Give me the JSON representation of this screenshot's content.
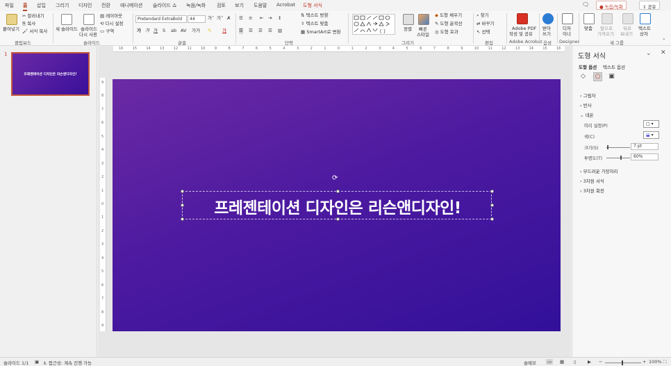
{
  "tabs": [
    "파일",
    "홈",
    "삽입",
    "그리기",
    "디자인",
    "전환",
    "애니메이션",
    "슬라이드 쇼",
    "녹음/녹화",
    "검토",
    "보기",
    "도움말",
    "Acrobat",
    "도형 서식"
  ],
  "top_buttons": {
    "record": "● 녹음/녹화",
    "share": "공유"
  },
  "ribbon": {
    "clipboard": {
      "label": "클립보드",
      "paste": "붙여넣기",
      "cut": "잘라내기",
      "copy": "복사",
      "format_painter": "서식 복사"
    },
    "slides": {
      "label": "슬라이드",
      "new_slide": "새 슬라이드",
      "reuse": "슬라이드",
      "reuse2": "다시 사용",
      "layout": "레이아웃",
      "reset": "다시 설정",
      "section": "구역"
    },
    "font": {
      "label": "글꼴",
      "font_name": "Pretendard ExtraBold",
      "font_size": "44",
      "grow": "가˄",
      "shrink": "가˅"
    },
    "paragraph": {
      "label": "단락",
      "text_direction": "텍스트 방향",
      "align_text": "텍스트 맞춤",
      "smartart": "SmartArt로 변환"
    },
    "drawing": {
      "label": "그리기",
      "arrange": "정렬",
      "quick_styles": "빠른",
      "quick_styles2": "스타일",
      "fill": "도형 채우기",
      "outline": "도형 윤곽선",
      "effects": "도형 효과"
    },
    "editing": {
      "label": "편집",
      "find": "찾기",
      "replace": "바꾸기",
      "select": "선택"
    },
    "acrobat": {
      "label": "Adobe Acrobat",
      "create": "Adobe PDF",
      "create2": "작성 및 공유"
    },
    "voice": {
      "label": "음성",
      "dictate": "받아",
      "dictate2": "쓰기"
    },
    "designer": {
      "label": "Designer",
      "design": "디자",
      "design2": "이너"
    },
    "new_group": {
      "label": "새 그룹",
      "fit": "맞춤",
      "front": "앞으로",
      "front2": "가져오기",
      "back": "뒤로",
      "back2": "보내기",
      "textbox": "텍스트",
      "textbox2": "상자"
    }
  },
  "thumbnail": {
    "number": "1",
    "text": "프레젠테이션 디자인은 리슨앤디자인!"
  },
  "slide": {
    "title": "프레젠테이션 디자인은 리슨앤디자인!"
  },
  "ruler": {
    "h_ticks": [
      "16",
      "15",
      "14",
      "13",
      "12",
      "11",
      "10",
      "9",
      "8",
      "7",
      "6",
      "5",
      "4",
      "3",
      "2",
      "1",
      "0",
      "1",
      "2",
      "3",
      "4",
      "5",
      "6",
      "7",
      "8",
      "9",
      "10",
      "11",
      "12",
      "13",
      "14",
      "15",
      "16"
    ],
    "v_ticks": [
      "9",
      "8",
      "7",
      "6",
      "5",
      "4",
      "3",
      "2",
      "1",
      "0",
      "1",
      "2",
      "3",
      "4",
      "5",
      "6",
      "7",
      "8",
      "9"
    ]
  },
  "pane": {
    "title": "도형 서식",
    "tab_shape": "도형 옵션",
    "tab_text": "텍스트 옵션",
    "sections": {
      "shadow": "그림자",
      "reflection": "반사",
      "glow": "네온",
      "soft_edges": "부드러운 가장자리",
      "format3d": "3차원 서식",
      "rotation3d": "3차원 회전"
    },
    "glow": {
      "presets": "미리 설정(P)",
      "color": "색(C)",
      "size": "크기(S)",
      "size_value": "7 pt",
      "transparency": "투명도(T)",
      "transparency_value": "60%"
    }
  },
  "status": {
    "slide": "슬라이드 1/1",
    "accessibility": "접근성: 계속 진행 가능",
    "notes": "슬메모",
    "zoom": "100%"
  }
}
